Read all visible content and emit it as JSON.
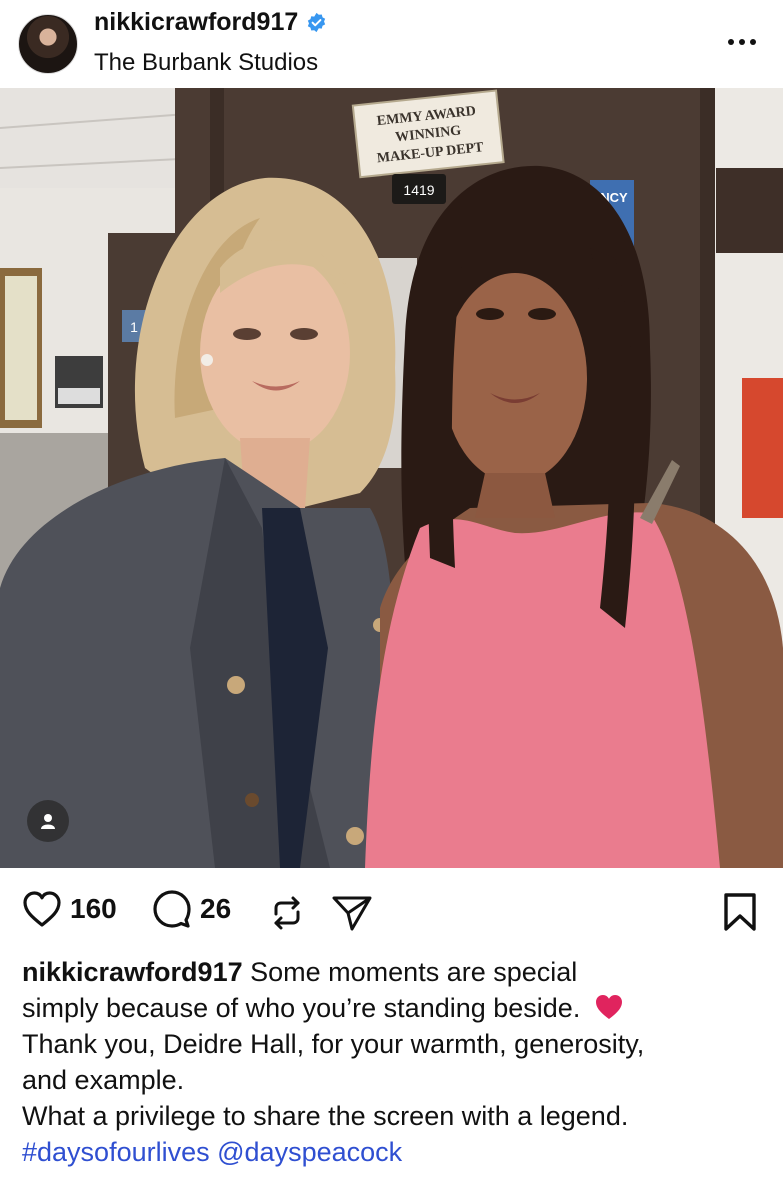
{
  "post": {
    "username": "nikkicrawford917",
    "location": "The Burbank Studios",
    "verified": true
  },
  "photo": {
    "sign_line1": "EMMY AWARD",
    "sign_line2": "WINNING",
    "sign_line3": "MAKE-UP DEPT",
    "room_number": "1419",
    "partial_sign": "NCY",
    "door_number": "1"
  },
  "actions": {
    "likes": "160",
    "comments": "26"
  },
  "caption": {
    "username": "nikkicrawford917",
    "line1": "Some moments are special",
    "line2": "simply because of who you’re standing beside.",
    "line3": "Thank you, Deidre Hall, for your warmth, generosity,",
    "line4": "and example.",
    "line5": "What a privilege to share the screen with a legend.",
    "hashtag": "#daysofourlives",
    "mention": "@dayspeacock"
  },
  "icons": [
    "verified-badge-icon",
    "more-options-icon",
    "user-tag-icon",
    "heart-icon",
    "comment-icon",
    "repost-icon",
    "share-icon",
    "bookmark-icon",
    "red-heart-emoji-icon"
  ],
  "colors": {
    "verified": "#3897f0",
    "link": "#2f4fd1",
    "heart_emoji": "#e0245e"
  }
}
